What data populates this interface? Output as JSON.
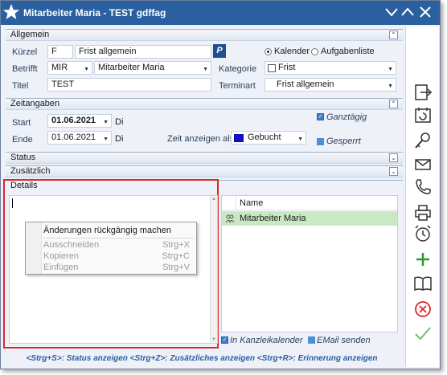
{
  "window": {
    "title": "Mitarbeiter Maria - TEST  gdffag"
  },
  "sections": {
    "allgemein": "Allgemein",
    "zeitangaben": "Zeitangaben",
    "status": "Status",
    "zusaetzlich": "Zusätzlich",
    "details": "Details"
  },
  "allgemein": {
    "kuerzel_label": "Kürzel",
    "kuerzel_value": "F",
    "frist_value": "Frist allgemein",
    "p_button": "P",
    "kalender_label": "Kalender",
    "aufgabenliste_label": "Aufgabenliste",
    "betrifft_label": "Betrifft",
    "betrifft_code": "MIR",
    "betrifft_name": "Mitarbeiter Maria",
    "kategorie_label": "Kategorie",
    "kategorie_value": "Frist",
    "titel_label": "Titel",
    "titel_value": "TEST",
    "terminart_label": "Terminart",
    "terminart_value": "Frist allgemein"
  },
  "zeitangaben": {
    "start_label": "Start",
    "start_date": "01.06.2021",
    "start_day": "Di",
    "ende_label": "Ende",
    "ende_date": "01.06.2021",
    "ende_day": "Di",
    "zeit_anzeigen_label": "Zeit anzeigen als",
    "zeit_anzeigen_value": "Gebucht",
    "ganztaegig_label": "Ganztägig",
    "gesperrt_label": "Gesperrt"
  },
  "context_menu": {
    "undo": "Änderungen rückgängig machen",
    "cut": "Ausschneiden",
    "cut_key": "Strg+X",
    "copy": "Kopieren",
    "copy_key": "Strg+C",
    "paste": "Einfügen",
    "paste_key": "Strg+V"
  },
  "participants": {
    "column_name": "Name",
    "rows": [
      "Mitarbeiter Maria"
    ],
    "in_kanzleikalender": "In Kanzleikalender",
    "email_senden": "EMail senden"
  },
  "statusbar": "<Strg+S>: Status anzeigen <Strg+Z>: Zusätzliches anzeigen <Strg+R>: Erinnerung anzeigen",
  "colors": {
    "titlebar": "#2a5fa0",
    "highlight_row": "#c9e9c4",
    "details_border": "#d9272e",
    "gebucht": "#1010c0"
  }
}
